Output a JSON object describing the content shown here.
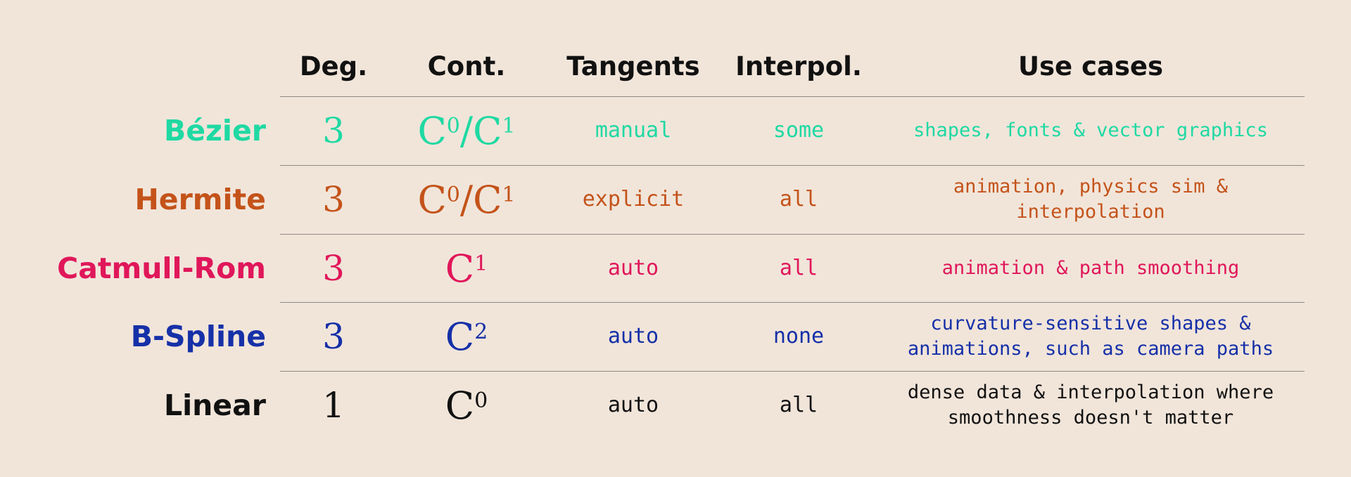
{
  "headers": {
    "deg": "Deg.",
    "cont": "Cont.",
    "tangents": "Tangents",
    "interpol": "Interpol.",
    "use_cases": "Use cases"
  },
  "rows": [
    {
      "name": "Bézier",
      "color": "#1fd9a3",
      "degree": "3",
      "continuity": [
        {
          "base": "C",
          "sup": "0"
        },
        {
          "sep": "/"
        },
        {
          "base": "C",
          "sup": "1"
        }
      ],
      "tangents": "manual",
      "interpolation": "some",
      "use_cases": "shapes, fonts & vector graphics"
    },
    {
      "name": "Hermite",
      "color": "#c4531a",
      "degree": "3",
      "continuity": [
        {
          "base": "C",
          "sup": "0"
        },
        {
          "sep": "/"
        },
        {
          "base": "C",
          "sup": "1"
        }
      ],
      "tangents": "explicit",
      "interpolation": "all",
      "use_cases": "animation, physics sim &\ninterpolation"
    },
    {
      "name": "Catmull-Rom",
      "color": "#e0175a",
      "degree": "3",
      "continuity": [
        {
          "base": "C",
          "sup": "1"
        }
      ],
      "tangents": "auto",
      "interpolation": "all",
      "use_cases": "animation & path smoothing"
    },
    {
      "name": "B-Spline",
      "color": "#1630a8",
      "degree": "3",
      "continuity": [
        {
          "base": "C",
          "sup": "2"
        }
      ],
      "tangents": "auto",
      "interpolation": "none",
      "use_cases": "curvature-sensitive shapes &\nanimations, such as camera paths"
    },
    {
      "name": "Linear",
      "color": "#111111",
      "degree": "1",
      "continuity": [
        {
          "base": "C",
          "sup": "0"
        }
      ],
      "tangents": "auto",
      "interpolation": "all",
      "use_cases": "dense data & interpolation where\nsmoothness doesn't matter"
    }
  ]
}
